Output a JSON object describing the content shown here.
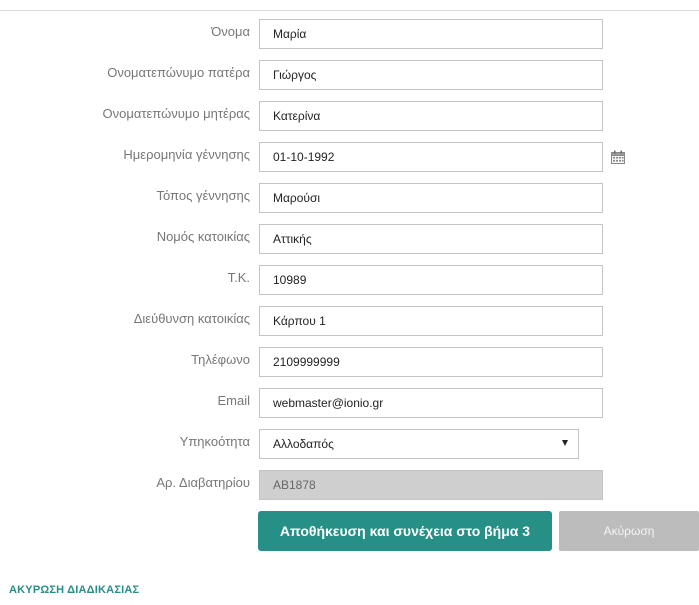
{
  "form": {
    "fields": [
      {
        "label": "Όνομα",
        "value": "Μαρία"
      },
      {
        "label": "Ονοματεπώνυμο πατέρα",
        "value": "Γιώργος"
      },
      {
        "label": "Ονοματεπώνυμο μητέρας",
        "value": "Κατερίνα"
      },
      {
        "label": "Ημερομηνία γέννησης",
        "value": "01-10-1992"
      },
      {
        "label": "Τόπος γέννησης",
        "value": "Μαρούσι"
      },
      {
        "label": "Νομός κατοικίας",
        "value": "Αττικής"
      },
      {
        "label": "Τ.Κ.",
        "value": "10989"
      },
      {
        "label": "Διεύθυνση κατοικίας",
        "value": "Κάρπου 1"
      },
      {
        "label": "Τηλέφωνο",
        "value": "2109999999"
      },
      {
        "label": "Email",
        "value": "webmaster@ionio.gr"
      },
      {
        "label": "Υπηκοότητα",
        "value": "Αλλοδαπός"
      },
      {
        "label": "Αρ. Διαβατηρίου",
        "value": "AB1878"
      }
    ]
  },
  "icons": {
    "date_picker": "calendar-icon",
    "select_arrow": "chevron-down-icon"
  },
  "actions": {
    "save_label": "Αποθήκευση και συνέχεια στο βήμα 3",
    "cancel_label": "Ακύρωση"
  },
  "footer": {
    "cancel_process_label": "ΑΚΥΡΩΣΗ ΔΙΑΔΙΚΑΣΙΑΣ"
  },
  "colors": {
    "accent": "#268f86",
    "secondary_button": "#bcbcbc",
    "disabled_field": "#cfcfcf"
  }
}
